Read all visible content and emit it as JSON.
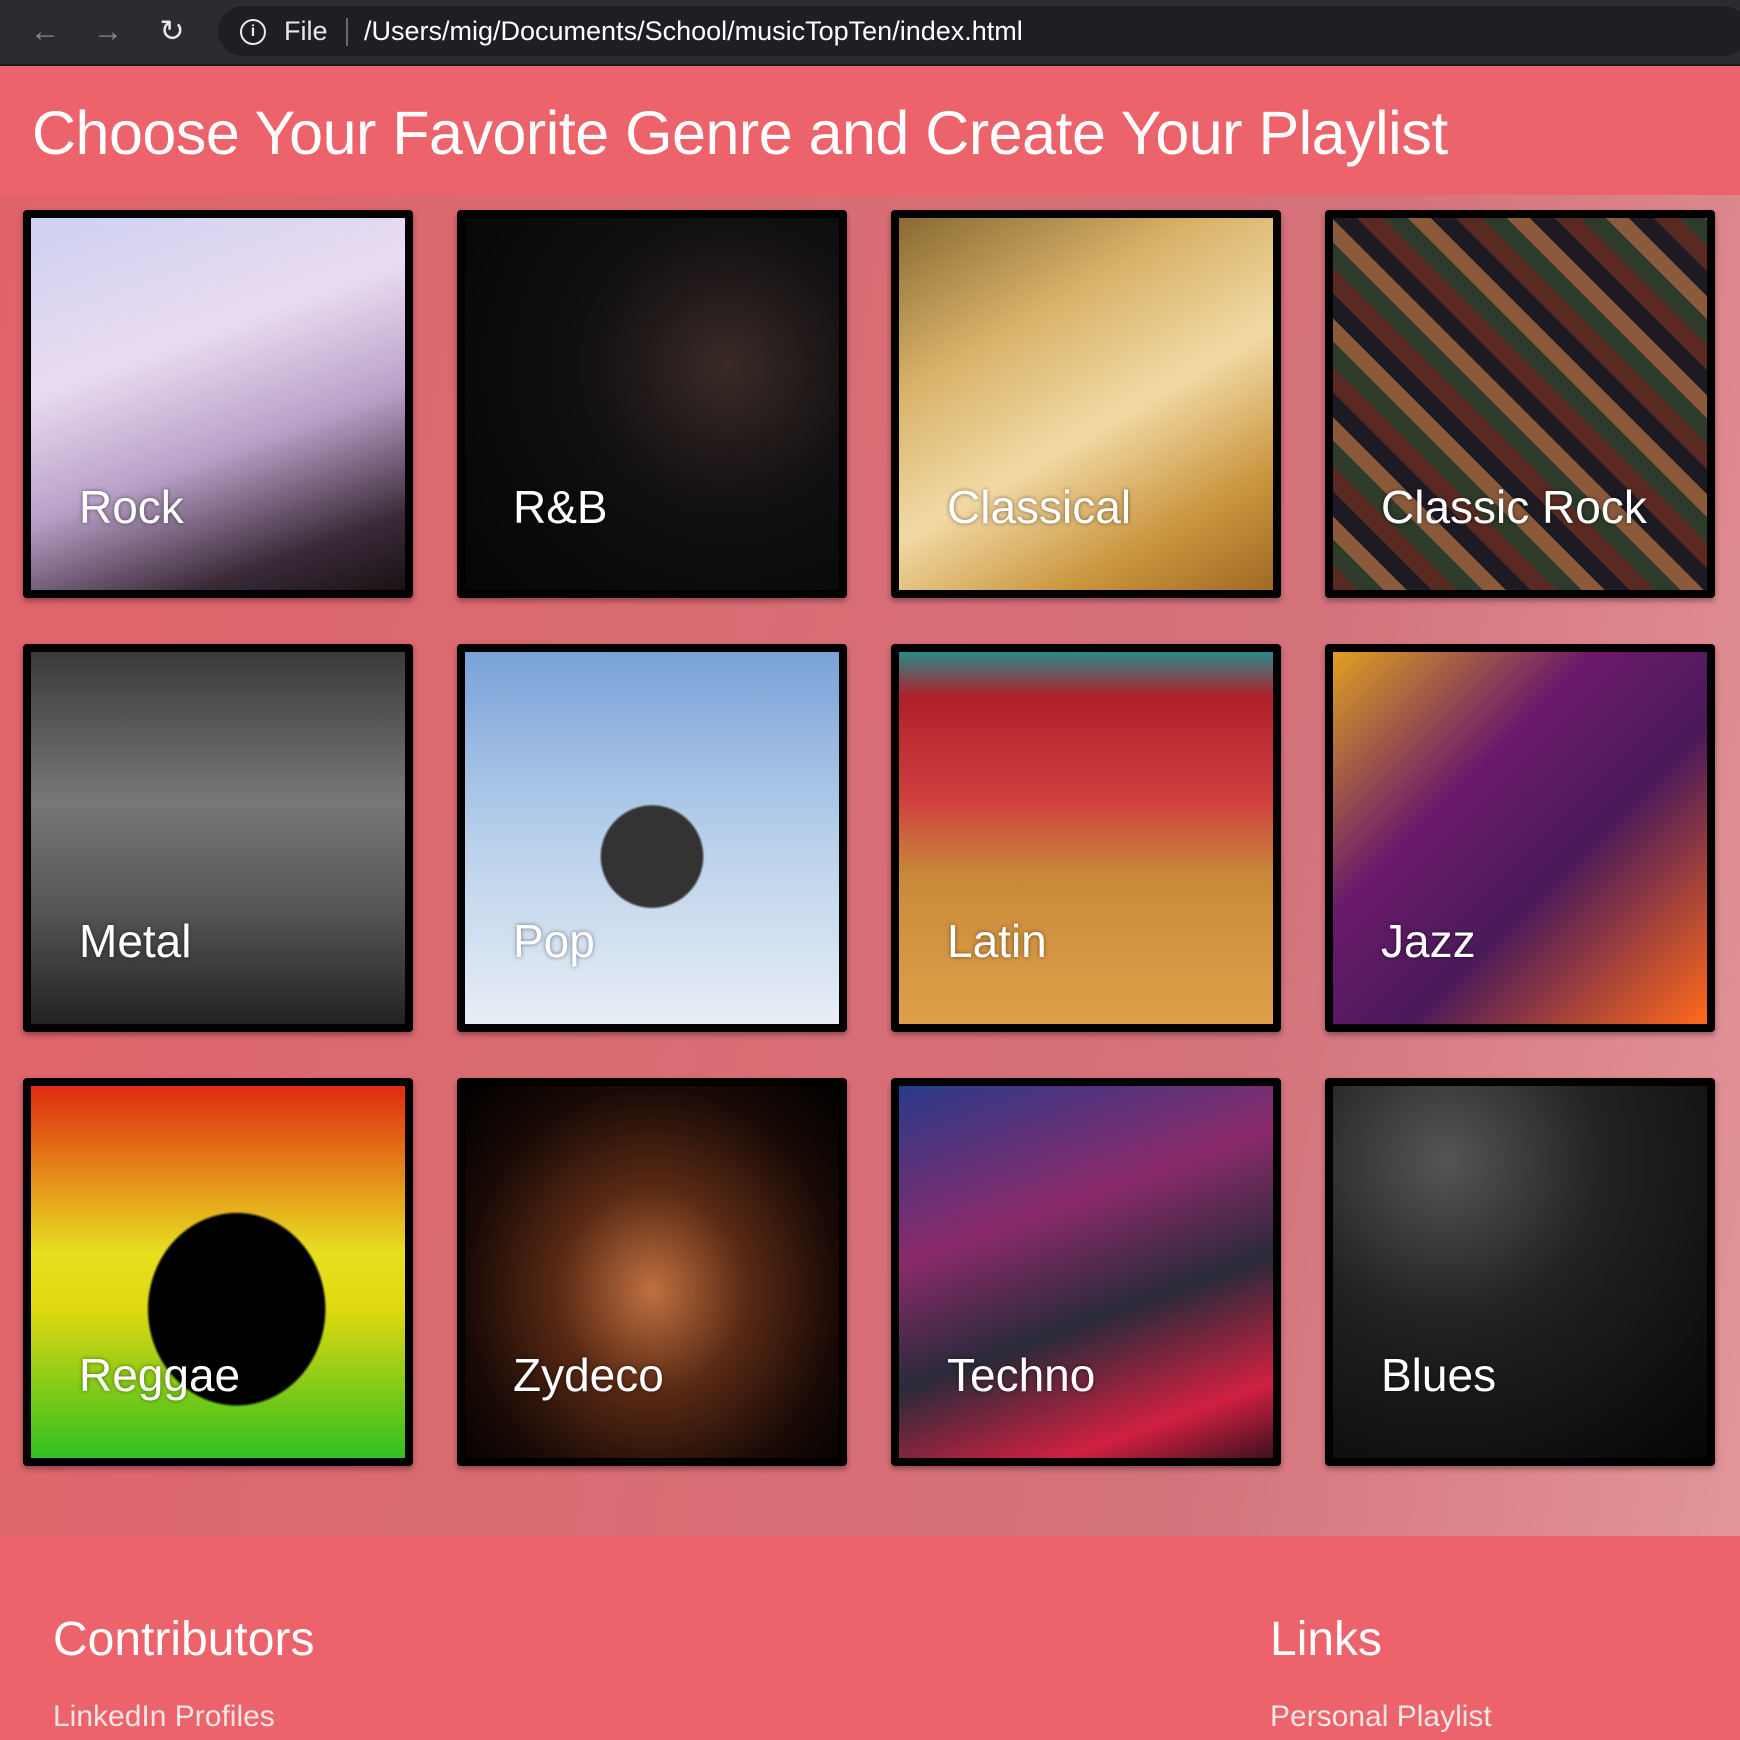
{
  "browser": {
    "back_icon": "arrow-left",
    "forward_icon": "arrow-right",
    "reload_icon": "reload",
    "info_icon": "info-circle",
    "scheme": "File",
    "url": "/Users/mig/Documents/School/musicTopTen/index.html"
  },
  "header": {
    "title": "Choose Your Favorite Genre and Create Your Playlist"
  },
  "genres": [
    {
      "label": "Rock"
    },
    {
      "label": "R&B"
    },
    {
      "label": "Classical"
    },
    {
      "label": "Classic Rock"
    },
    {
      "label": "Metal"
    },
    {
      "label": "Pop"
    },
    {
      "label": "Latin"
    },
    {
      "label": "Jazz"
    },
    {
      "label": "Reggae"
    },
    {
      "label": "Zydeco"
    },
    {
      "label": "Techno"
    },
    {
      "label": "Blues"
    }
  ],
  "footer": {
    "contributors_heading": "Contributors",
    "contributors_link": "LinkedIn Profiles",
    "links_heading": "Links",
    "links_link": "Personal Playlist"
  },
  "colors": {
    "accent": "#ec636b",
    "card_border": "#000000"
  }
}
